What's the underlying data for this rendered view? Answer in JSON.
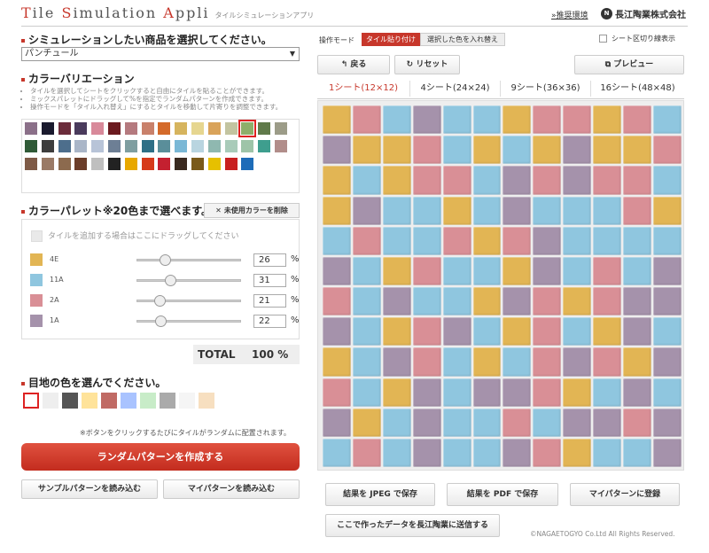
{
  "header": {
    "title_parts": [
      {
        "cap": "T",
        "rest": "ile "
      },
      {
        "cap": "S",
        "rest": "imulation "
      },
      {
        "cap": "A",
        "rest": "ppli"
      }
    ],
    "title_sub": "タイルシミュレーションアプリ",
    "env_link": "»推奨環境",
    "company": "長江陶業株式会社",
    "company_logo_icon": "nagae-logo-icon"
  },
  "product": {
    "heading": "シミュレーションしたい商品を選択してください。",
    "selected": "パンチュール"
  },
  "color_variation": {
    "heading": "カラーバリエーション",
    "notes": [
      "タイルを選択してシートをクリックすると自由にタイルを貼ることができます。",
      "ミックスパレットにドラッグして%を指定でランダムパターンを作成できます。",
      "操作モードを「タイル入れ替え」にするとタイルを移動して片寄りを調整できます。"
    ],
    "swatches": [
      "#8b7089",
      "#1a1a2e",
      "#6b2c3b",
      "#4a3b5c",
      "#d8899a",
      "#6b1a1f",
      "#b57a7f",
      "#c9816b",
      "#d46a2a",
      "#d6b45e",
      "#e6d690",
      "#d9a35a",
      "#c3c4a0",
      "#8eae6a",
      "#607a4a",
      "#9c9c88",
      "#2f5a37",
      "#3d3d3d",
      "#4d6e8c",
      "#aab6c8",
      "#b8c4d8",
      "#6d7f95",
      "#7f9ea0",
      "#2e6f86",
      "#5a8e9a",
      "#7ab8d6",
      "#b9d5e0",
      "#8fb8b0",
      "#a9cbb9",
      "#9ec4a8",
      "#3e9e8e",
      "#b18d8a",
      "#7e5a46",
      "#9a7a66",
      "#8c6a4e",
      "#6b3e2a",
      "#bfbfbf",
      "#222222",
      "#e8a800",
      "#d63a1a",
      "#c42030",
      "#3a2a20",
      "#7a5a1a",
      "#e6c000",
      "#c82020",
      "#1e6cb8"
    ],
    "selected_index": 13
  },
  "palette": {
    "heading": "カラーパレット※20色まで選べます。",
    "remove_unused": "未使用カラーを削除",
    "drop_hint": "タイルを追加する場合はここにドラッグしてください",
    "items": [
      {
        "code": "4E",
        "color": "#e2b554",
        "percent": "26",
        "slider": 0.26
      },
      {
        "code": "11A",
        "color": "#8fc6df",
        "percent": "31",
        "slider": 0.31
      },
      {
        "code": "2A",
        "color": "#d98f96",
        "percent": "21",
        "slider": 0.21
      },
      {
        "code": "1A",
        "color": "#a592ab",
        "percent": "22",
        "slider": 0.22
      }
    ],
    "pct_symbol": "%",
    "total_label": "TOTAL",
    "total_value": "100 %"
  },
  "joint": {
    "heading": "目地の色を選んでください。",
    "colors": [
      "#ffffff",
      "#eeeeee",
      "#555555",
      "#ffe39a",
      "#c06a64",
      "#a9c3ff",
      "#c8ecc8",
      "#aaaaaa",
      "#f5f5f5",
      "#f7dfc0"
    ],
    "selected_index": 0
  },
  "actions": {
    "random_note": "※ボタンをクリックするたびにタイルがランダムに配置されます。",
    "random_button": "ランダムパターンを作成する",
    "load_sample": "サンプルパターンを読み込む",
    "load_mine": "マイパターンを読み込む"
  },
  "toolbar": {
    "mode_label": "操作モード",
    "mode_active": "タイル貼り付け",
    "mode_swap": "選択した色を入れ替え",
    "sheet_lines": "シート区切り線表示",
    "back": "戻る",
    "back_icon": "back-arrow-icon",
    "reset": "リセット",
    "reset_icon": "refresh-icon",
    "preview": "プレビュー",
    "preview_icon": "preview-icon"
  },
  "tabs": [
    "1シート(12×12)",
    "4シート(24×24)",
    "9シート(36×36)",
    "16シート(48×48)"
  ],
  "tab_active": 0,
  "tile_colors": {
    "Y": "#e2b554",
    "B": "#8fc6df",
    "P": "#d98f96",
    "V": "#a592ab"
  },
  "tile_rows": [
    "YPBVBBYPPYPB",
    "VYYPBYBYVYYP",
    "YBYPPBVPVPPB",
    "YVBBYBVBBBPY",
    "BPBBPYPVBBBB",
    "VBYPBBYVBPBV",
    "PBVBBYVPYPVV",
    "VBYPVBYPBYVB",
    "YBVPBYBPVPYV",
    "PBYVBVVPYBVB",
    "VYBVBBPBVVPV",
    "BPBVBBVPYBBV"
  ],
  "bottom": {
    "save_jpeg": "結果を JPEG で保存",
    "save_pdf": "結果を PDF で保存",
    "register": "マイパターンに登録",
    "send": "ここで作ったデータを長江陶業に送信する",
    "copyright": "©NAGAETOGYO Co.Ltd All Rights Reserved."
  }
}
